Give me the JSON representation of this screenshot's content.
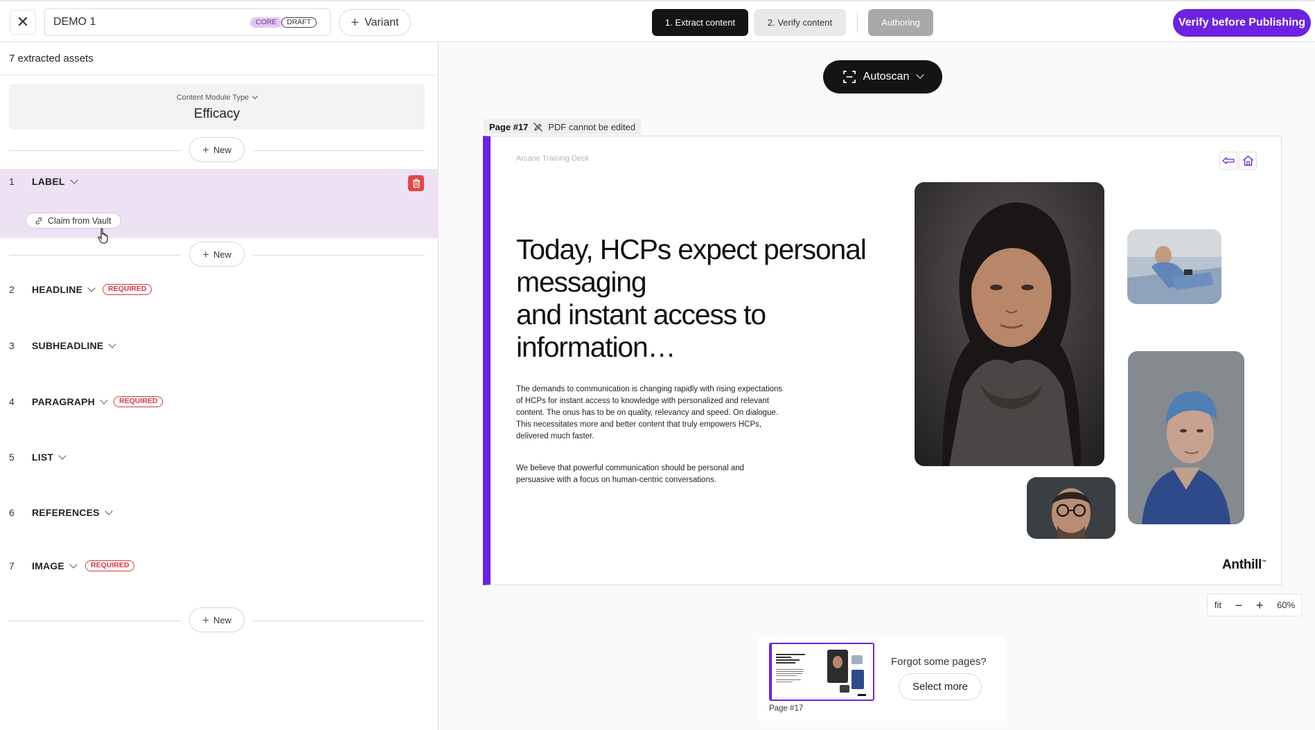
{
  "header": {
    "title": "DEMO 1",
    "badge_core": "CORE",
    "badge_draft": "DRAFT",
    "variant_label": "Variant",
    "steps": [
      "1. Extract content",
      "2. Verify content",
      "Authoring"
    ],
    "publish_label": "Verify before Publishing"
  },
  "left": {
    "assets_count": "7 extracted assets",
    "module_type_label": "Content Module Type",
    "module_type_value": "Efficacy",
    "new_label": "New",
    "claim_label": "Claim from Vault",
    "required_label": "REQUIRED",
    "items": [
      {
        "num": "1",
        "name": "LABEL"
      },
      {
        "num": "2",
        "name": "HEADLINE"
      },
      {
        "num": "3",
        "name": "SUBHEADLINE"
      },
      {
        "num": "4",
        "name": "PARAGRAPH"
      },
      {
        "num": "5",
        "name": "LIST"
      },
      {
        "num": "6",
        "name": "REFERENCES"
      },
      {
        "num": "7",
        "name": "IMAGE"
      }
    ]
  },
  "workspace": {
    "autoscan_label": "Autoscan",
    "page_tag": "Page #17",
    "pdf_note": "PDF cannot be edited",
    "zoom_fit": "fit",
    "zoom_level": "60%",
    "thumb_label": "Page #17",
    "forgot_text": "Forgot some pages?",
    "select_more_label": "Select more"
  },
  "slide": {
    "deck_name": "Arcane Training Deck",
    "headline_lines": [
      "Today, HCPs expect personal",
      "messaging",
      "and instant access to",
      "information…"
    ],
    "body": "The demands to communication is changing rapidly with rising expectations of HCPs for instant access to knowledge with personalized and relevant content. The onus has to be on quality, relevancy and speed. On dialogue. This necessitates more and better content that truly empowers HCPs, delivered much faster.",
    "body2": "We believe that powerful communication should be personal and persuasive with a focus on human-centric conversations.",
    "logo": "Anthill",
    "logo_mark": "™"
  },
  "colors": {
    "accent": "#6d22e0",
    "required": "#d9363e",
    "selected_row": "#ede2f3",
    "dark_button": "#141414"
  }
}
